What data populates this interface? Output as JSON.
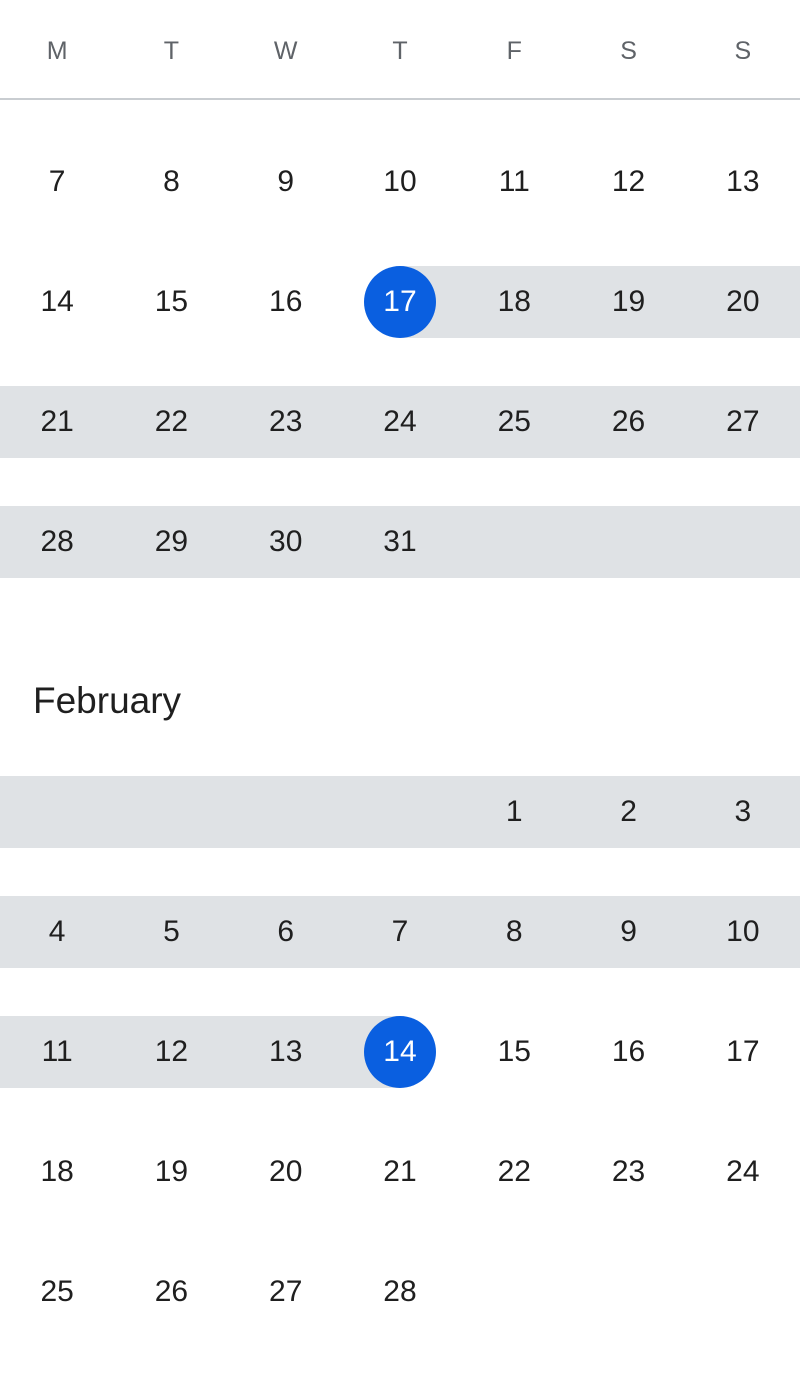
{
  "weekdays": [
    "M",
    "T",
    "W",
    "T",
    "F",
    "S",
    "S"
  ],
  "colors": {
    "accent": "#0a5fe0",
    "range_fill": "#dfe2e5",
    "weekday_text": "#5f6368",
    "day_text": "#1f1f1f",
    "divider": "#c9cdd1"
  },
  "selection": {
    "start": {
      "month_index": 0,
      "day": "17"
    },
    "end": {
      "month_index": 1,
      "day": "14"
    }
  },
  "months": [
    {
      "name": "",
      "weeks": [
        [
          "7",
          "8",
          "9",
          "10",
          "11",
          "12",
          "13"
        ],
        [
          "14",
          "15",
          "16",
          "17",
          "18",
          "19",
          "20"
        ],
        [
          "21",
          "22",
          "23",
          "24",
          "25",
          "26",
          "27"
        ],
        [
          "28",
          "29",
          "30",
          "31",
          "",
          "",
          ""
        ]
      ]
    },
    {
      "name": "February",
      "weeks": [
        [
          "",
          "",
          "",
          "",
          "1",
          "2",
          "3"
        ],
        [
          "4",
          "5",
          "6",
          "7",
          "8",
          "9",
          "10"
        ],
        [
          "11",
          "12",
          "13",
          "14",
          "15",
          "16",
          "17"
        ],
        [
          "18",
          "19",
          "20",
          "21",
          "22",
          "23",
          "24"
        ],
        [
          "25",
          "26",
          "27",
          "28",
          "",
          "",
          ""
        ]
      ]
    }
  ]
}
